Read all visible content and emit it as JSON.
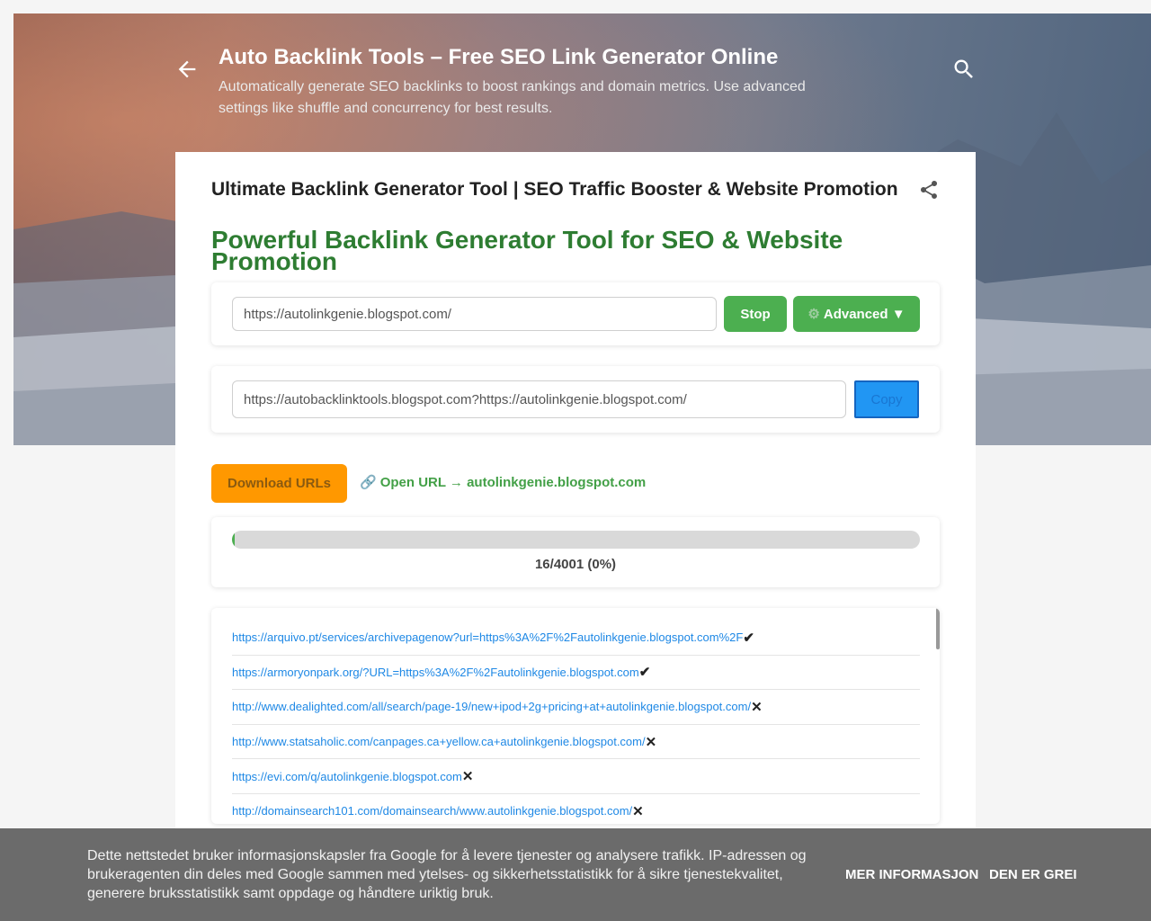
{
  "header": {
    "site_title": "Auto Backlink Tools – Free SEO Link Generator Online",
    "site_description": "Automatically generate SEO backlinks to boost rankings and domain metrics. Use advanced settings like shuffle and concurrency for best results."
  },
  "post": {
    "title": "Ultimate Backlink Generator Tool | SEO Traffic Booster & Website Promotion",
    "tool_heading": "Powerful Backlink Generator Tool for SEO & Website Promotion"
  },
  "tool": {
    "url_value": "https://autolinkgenie.blogspot.com/",
    "stop_label": "Stop",
    "advanced_label": "Advanced ▼",
    "result_value": "https://autobacklinktools.blogspot.com?https://autolinkgenie.blogspot.com/",
    "copy_label": "Copy",
    "download_label": "Download URLs",
    "open_url_label": "Open URL → autolinkgenie.blogspot.com",
    "progress_text": "16/4001 (0%)",
    "progress_fraction": 0.004
  },
  "url_list": [
    {
      "url": "https://arquivo.pt/services/archivepagenow?url=https%3A%2F%2Fautolinkgenie.blogspot.com%2F",
      "status": "✔"
    },
    {
      "url": "https://armoryonpark.org/?URL=https%3A%2F%2Fautolinkgenie.blogspot.com",
      "status": "✔"
    },
    {
      "url": "http://www.dealighted.com/all/search/page-19/new+ipod+2g+pricing+at+autolinkgenie.blogspot.com/",
      "status": "✕"
    },
    {
      "url": "http://www.statsaholic.com/canpages.ca+yellow.ca+autolinkgenie.blogspot.com/",
      "status": "✕"
    },
    {
      "url": "https://evi.com/q/autolinkgenie.blogspot.com",
      "status": "✕"
    },
    {
      "url": "http://domainsearch101.com/domainsearch/www.autolinkgenie.blogspot.com/",
      "status": "✕"
    }
  ],
  "cookie_bar": {
    "text": "Dette nettstedet bruker informasjonskapsler fra Google for å levere tjenester og analysere trafikk. IP-adressen og brukeragenten din deles med Google sammen med ytelses- og sikkerhetsstatistikk for å sikre tjenestekvalitet, generere bruksstatistikk samt oppdage og håndtere uriktig bruk.",
    "more_info_label": "MER INFORMASJON",
    "agree_label": "DEN ER GREI"
  },
  "colors": {
    "accent_green": "#4caf50",
    "heading_green": "#2e7d32",
    "copy_blue": "#2196f3",
    "download_orange": "#ff9800",
    "link_blue": "#1e88e5"
  },
  "icons": [
    "back-arrow-icon",
    "search-icon",
    "share-icon",
    "gear-icon",
    "link-icon"
  ]
}
